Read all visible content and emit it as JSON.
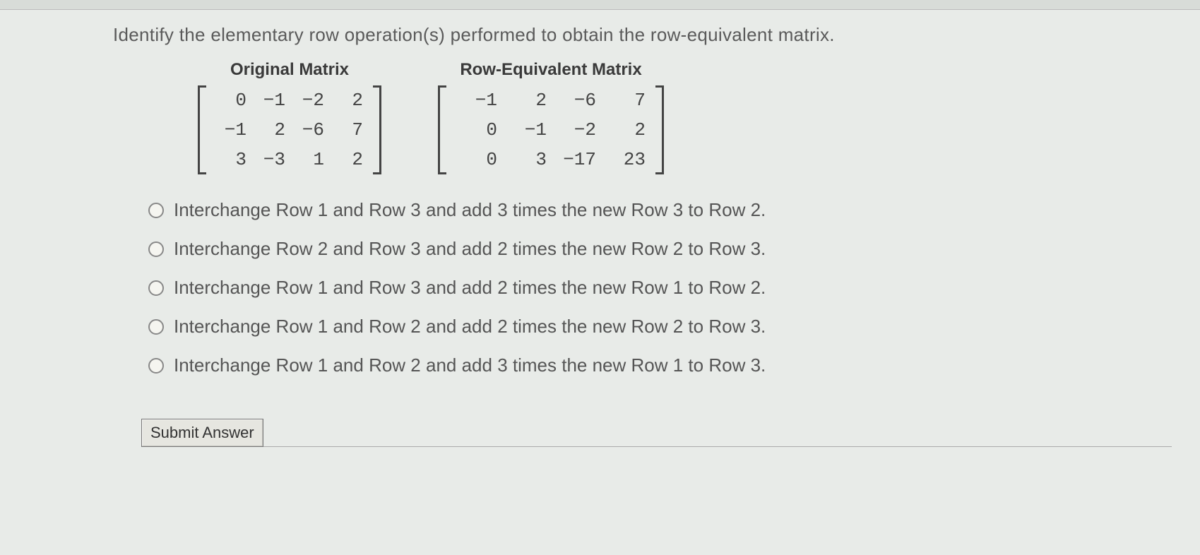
{
  "question": "Identify the elementary row operation(s) performed to obtain the row-equivalent matrix.",
  "matrixA": {
    "title": "Original Matrix",
    "rows": [
      [
        "0",
        "−1",
        "−2",
        "2"
      ],
      [
        "−1",
        "2",
        "−6",
        "7"
      ],
      [
        "3",
        "−3",
        "1",
        "2"
      ]
    ]
  },
  "matrixB": {
    "title": "Row-Equivalent Matrix",
    "rows": [
      [
        "−1",
        "2",
        "−6",
        "7"
      ],
      [
        "0",
        "−1",
        "−2",
        "2"
      ],
      [
        "0",
        "3",
        "−17",
        "23"
      ]
    ]
  },
  "options": [
    "Interchange Row 1 and Row 3 and add 3 times the new Row 3 to Row 2.",
    "Interchange Row 2 and Row 3 and add 2 times the new Row 2 to Row 3.",
    "Interchange Row 1 and Row 3 and add 2 times the new Row 1 to Row 2.",
    "Interchange Row 1 and Row 2 and add 2 times the new Row 2 to Row 3.",
    "Interchange Row 1 and Row 2 and add 3 times the new Row 1 to Row 3."
  ],
  "submitLabel": "Submit Answer"
}
